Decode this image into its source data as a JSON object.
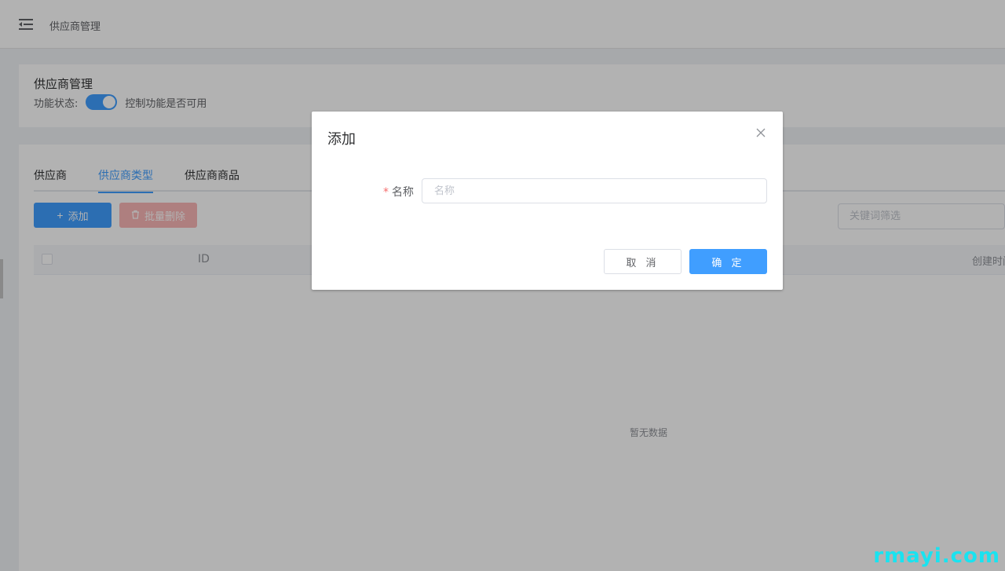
{
  "topbar": {
    "breadcrumb": "供应商管理"
  },
  "header": {
    "title": "供应商管理",
    "status_label": "功能状态:",
    "switch_on": true,
    "status_desc": "控制功能是否可用"
  },
  "tabs": [
    {
      "label": "供应商",
      "active": false
    },
    {
      "label": "供应商类型",
      "active": true
    },
    {
      "label": "供应商商品",
      "active": false
    }
  ],
  "toolbar": {
    "add_label": "添加",
    "batch_delete_label": "批量删除",
    "filter_placeholder": "关键词筛选"
  },
  "table": {
    "columns": [
      "ID",
      "创建时间"
    ],
    "empty_text": "暂无数据"
  },
  "dialog": {
    "title": "添加",
    "field_label": "名称",
    "field_required_mark": "*",
    "field_placeholder": "名称",
    "field_value": "",
    "cancel_label": "取 消",
    "confirm_label": "确 定"
  },
  "watermark": "rmayi.com",
  "colors": {
    "primary": "#409eff",
    "danger_disabled": "#fab6b6",
    "required": "#f56c6c",
    "watermark": "#19e3f0"
  }
}
